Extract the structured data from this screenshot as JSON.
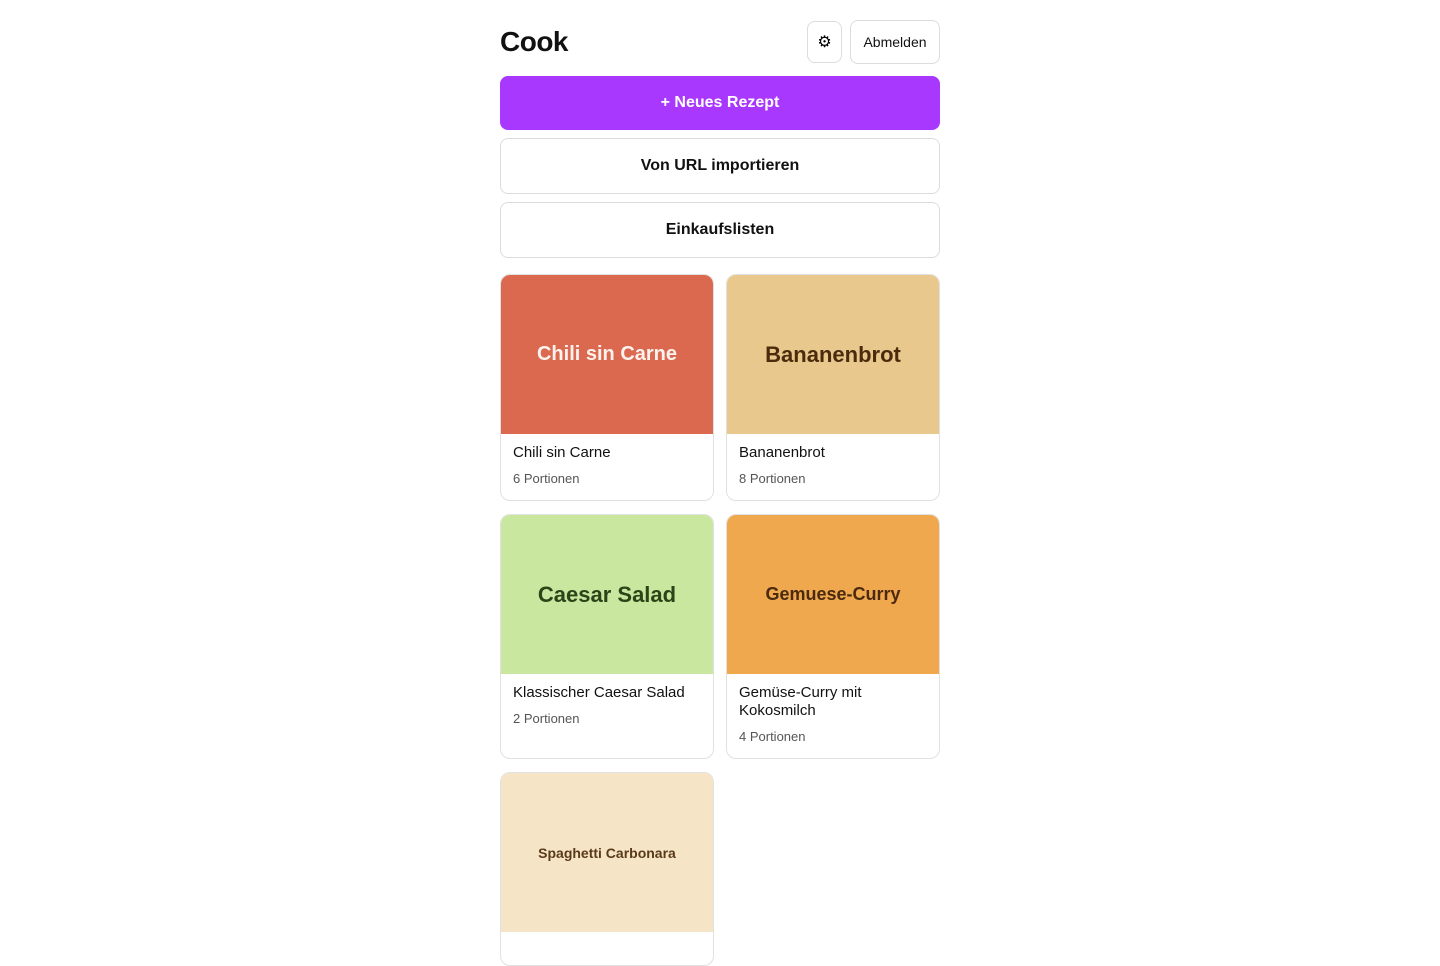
{
  "header": {
    "title": "Cook",
    "settings_icon": "gear-icon",
    "settings_glyph": "⚙",
    "logout_label": "Abmelden"
  },
  "actions": {
    "new_recipe_label": "+ Neues Rezept",
    "import_label": "Von URL importieren",
    "shopping_lists_label": "Einkaufslisten"
  },
  "colors": {
    "accent": "#a938ff"
  },
  "recipes": [
    {
      "cover_text": "Chili sin Carne",
      "title": "Chili sin Carne",
      "servings": "6 Portionen",
      "cover_bg": "#db6950",
      "cover_fg": "#fdf3ee",
      "cover_size": "20px"
    },
    {
      "cover_text": "Bananenbrot",
      "title": "Bananenbrot",
      "servings": "8 Portionen",
      "cover_bg": "#e8c88c",
      "cover_fg": "#4a2b0c",
      "cover_size": "22px"
    },
    {
      "cover_text": "Caesar Salad",
      "title": "Klassischer Caesar Salad",
      "servings": "2 Portionen",
      "cover_bg": "#cae79f",
      "cover_fg": "#2b4418",
      "cover_size": "22px"
    },
    {
      "cover_text": "Gemuese-Curry",
      "title": "Gemüse-Curry mit Kokosmilch",
      "servings": "4 Portionen",
      "cover_bg": "#efa84d",
      "cover_fg": "#4c2a10",
      "cover_size": "18px"
    },
    {
      "cover_text": "Spaghetti Carbonara",
      "title": "",
      "servings": "",
      "cover_bg": "#f5e5c6",
      "cover_fg": "#5a3a18",
      "cover_size": "14px"
    }
  ]
}
